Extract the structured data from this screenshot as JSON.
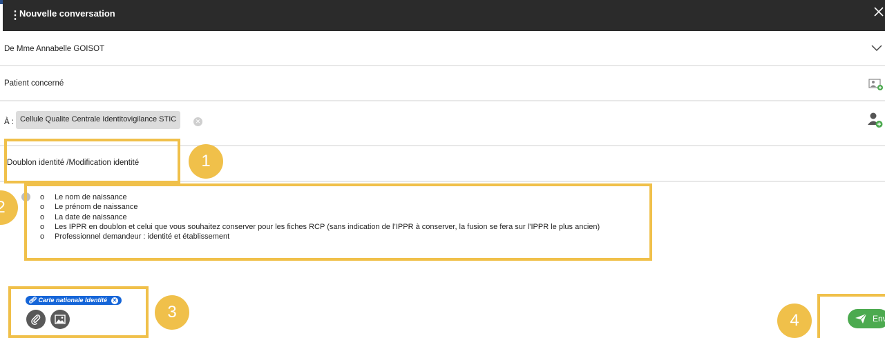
{
  "window": {
    "title": "Nouvelle conversation"
  },
  "form": {
    "from_prefix": "De ",
    "from_name": "Mme Annabelle GOISOT",
    "patient_label": "Patient concerné",
    "to_label": "À :",
    "recipient": "Cellule Qualite Centrale Identitovigilance STIC",
    "subject": "Doublon identité /Modification identité"
  },
  "body": {
    "bullet_marker": "o",
    "items": [
      "Le nom de naissance",
      "Le prénom de naissance",
      "La date de naissance",
      "Les IPPR en doublon et celui que vous souhaitez conserver pour les fiches RCP (sans indication de l’IPPR à conserver, la fusion se fera sur l’IPPR le plus ancien)",
      "Professionnel demandeur : identité et établissement"
    ]
  },
  "attachment": {
    "name": "Carte nationale Identité"
  },
  "actions": {
    "send_label": "Envoyer"
  },
  "annotations": [
    "1",
    "2",
    "3",
    "4"
  ],
  "colors": {
    "highlight": "#f0c04a",
    "header": "#2b2b2b",
    "accent_blue": "#1565d8",
    "send_green": "#4caa4f"
  }
}
